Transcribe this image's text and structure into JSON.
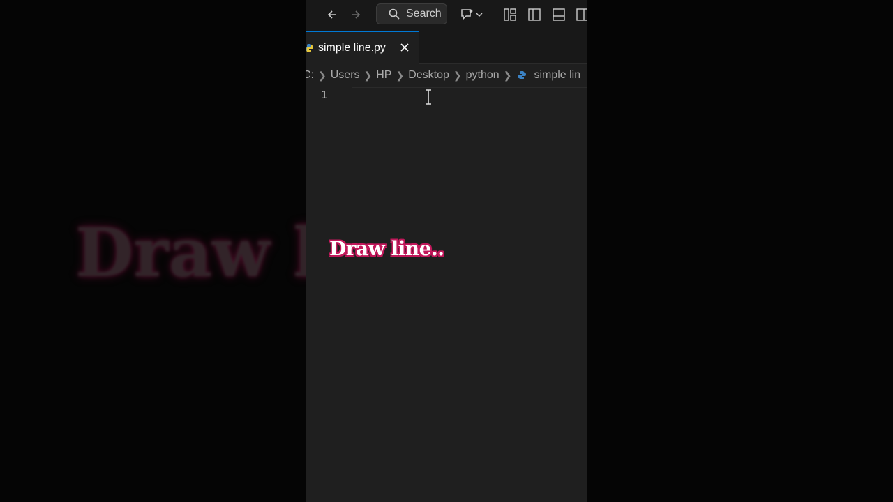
{
  "background": {
    "caption_blurred": "Draw li"
  },
  "titlebar": {
    "search_label": "Search",
    "icons": [
      "back-arrow-icon",
      "forward-arrow-icon",
      "search-icon",
      "copilot-chat-icon",
      "chevron-down-icon",
      "customize-layout-icon",
      "toggle-primary-sidebar-icon",
      "toggle-panel-icon",
      "toggle-secondary-sidebar-icon"
    ]
  },
  "tab": {
    "label": "simple line.py",
    "icon": "python-file-icon",
    "accent_color": "#0078d4"
  },
  "breadcrumb": {
    "items": [
      "C:",
      "Users",
      "HP",
      "Desktop",
      "python",
      "simple lin"
    ]
  },
  "editor": {
    "line_number": "1",
    "content": ""
  },
  "overlay": {
    "caption": "Draw line..",
    "outline_color": "#c2185b"
  }
}
